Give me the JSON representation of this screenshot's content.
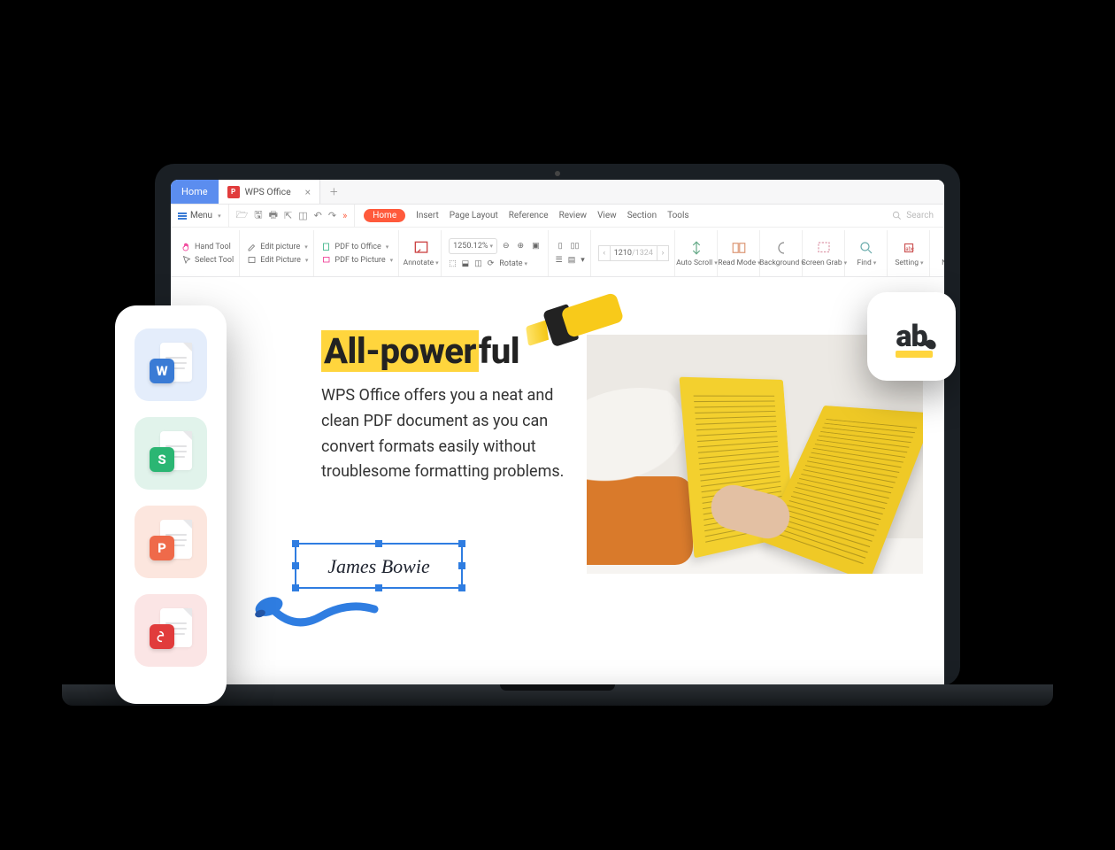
{
  "titlebar": {
    "home": "Home",
    "doc_name": "WPS Office",
    "pdf_badge": "P"
  },
  "menubar": {
    "menu": "Menu",
    "tabs": [
      "Home",
      "Insert",
      "Page Layout",
      "Reference",
      "Review",
      "View",
      "Section",
      "Tools"
    ],
    "search_placeholder": "Search"
  },
  "ribbon": {
    "hand_tool": "Hand Tool",
    "select_tool": "Select Tool",
    "edit_picture": "Edit picture",
    "edit_picture2": "Edit Picture",
    "pdf_to_office": "PDF to Office",
    "pdf_to_picture": "PDF to Picture",
    "annotate": "Annotate",
    "zoom": "1250.12%",
    "rotate": "Rotate",
    "page_current": "1210",
    "page_total": "/1324",
    "auto_scroll": "Auto Scroll",
    "read_mode": "Read Mode",
    "background": "Background",
    "screen_grab": "Screen Grab",
    "find": "Find",
    "setting": "Setting",
    "note": "Note"
  },
  "page": {
    "heading_hl": "All-power",
    "heading_rest": "ful",
    "paragraph": "WPS Office offers you a neat and clean PDF document as you can convert formats easily without troublesome formatting problems.",
    "signature": "James Bowie"
  },
  "sidecard": {
    "w": "W",
    "s": "S",
    "p": "P"
  },
  "ab": "ab"
}
